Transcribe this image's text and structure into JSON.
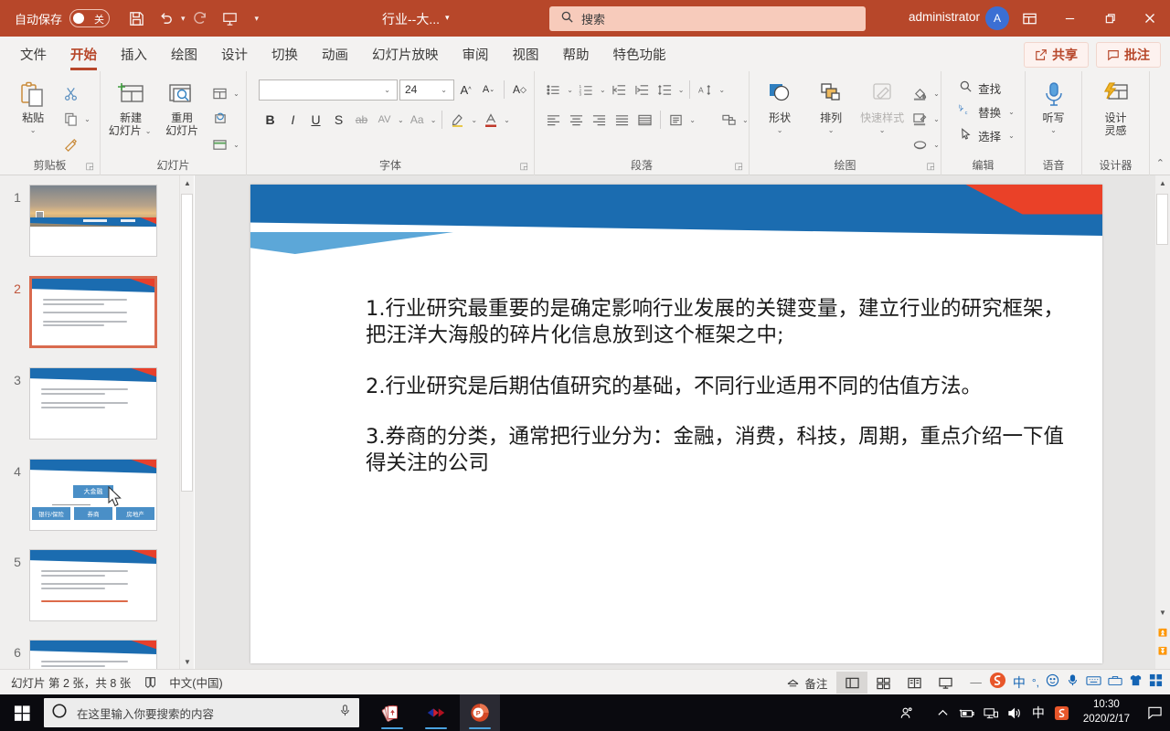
{
  "titlebar": {
    "autosave_label": "自动保存",
    "autosave_state": "关",
    "save_icon": "save-icon",
    "undo_icon": "undo-icon",
    "redo_icon": "redo-icon",
    "present_icon": "start-presentation-icon",
    "customize_icon": "customize-quick-access-icon",
    "document_title": "行业--大...",
    "search_placeholder": "搜索",
    "search_icon": "search-icon",
    "user_name": "administrator",
    "user_initial": "A",
    "ribbon_display_icon": "ribbon-display-options-icon",
    "minimize_label": "—",
    "restore_label": "❐",
    "close_label": "✕",
    "bg_color": "#b7472a",
    "search_bg": "#f7cbbb"
  },
  "menubar": {
    "tabs": [
      {
        "label": "文件",
        "active": false
      },
      {
        "label": "开始",
        "active": true
      },
      {
        "label": "插入",
        "active": false
      },
      {
        "label": "绘图",
        "active": false
      },
      {
        "label": "设计",
        "active": false
      },
      {
        "label": "切换",
        "active": false
      },
      {
        "label": "动画",
        "active": false
      },
      {
        "label": "幻灯片放映",
        "active": false
      },
      {
        "label": "审阅",
        "active": false
      },
      {
        "label": "视图",
        "active": false
      },
      {
        "label": "帮助",
        "active": false
      },
      {
        "label": "特色功能",
        "active": false
      }
    ],
    "share_label": "共享",
    "comment_label": "批注",
    "accent_color": "#b7472a"
  },
  "ribbon": {
    "clipboard": {
      "group_label": "剪贴板",
      "paste_label": "粘贴",
      "cut_name": "cut-icon",
      "copy_name": "copy-icon",
      "format_painter_name": "format-painter-icon"
    },
    "slides": {
      "group_label": "幻灯片",
      "new_slide_label": "新建\n幻灯片",
      "new_slide_line1": "新建",
      "new_slide_line2": "幻灯片",
      "reuse_label_line1": "重用",
      "reuse_label_line2": "幻灯片",
      "layout_name": "slide-layout-icon",
      "reset_name": "reset-slide-icon",
      "section_name": "slide-section-icon"
    },
    "font": {
      "group_label": "字体",
      "font_name_value": "",
      "font_size_value": "24",
      "grow_font": "A",
      "shrink_font": "A",
      "clear_format": "A",
      "bold": "B",
      "italic": "I",
      "underline": "U",
      "shadow": "S",
      "strikethrough": "ab",
      "char_spacing": "AV",
      "change_case": "Aa",
      "highlight_name": "text-highlight-icon",
      "font_color_name": "font-color-icon"
    },
    "paragraph": {
      "group_label": "段落",
      "bullets_name": "bullet-list-icon",
      "numbering_name": "numbered-list-icon",
      "decrease_indent_name": "decrease-indent-icon",
      "increase_indent_name": "increase-indent-icon",
      "line_spacing_name": "line-spacing-icon",
      "align_left_name": "align-left-icon",
      "align_center_name": "align-center-icon",
      "align_right_name": "align-right-icon",
      "justify_name": "justify-icon",
      "columns_name": "columns-icon",
      "smartart_name": "convert-to-smartart-icon",
      "text_direction_name": "text-direction-icon",
      "align_text_name": "align-text-icon"
    },
    "drawing": {
      "group_label": "绘图",
      "shapes_label": "形状",
      "arrange_label": "排列",
      "quick_styles_label": "快速样式",
      "shape_fill_name": "shape-fill-icon",
      "shape_outline_name": "shape-outline-icon",
      "shape_effects_name": "shape-effects-icon"
    },
    "editing": {
      "group_label": "编辑",
      "find_label": "查找",
      "replace_label": "替换",
      "select_label": "选择"
    },
    "voice": {
      "group_label": "语音",
      "dictate_label": "听写"
    },
    "designer": {
      "group_label": "设计器",
      "design_ideas_line1": "设计",
      "design_ideas_line2": "灵感"
    },
    "collapse_icon": "collapse-ribbon-icon"
  },
  "slide_panel": {
    "thumbnails": [
      {
        "number": "1",
        "selected": false,
        "kind": "cover"
      },
      {
        "number": "2",
        "selected": true,
        "kind": "text"
      },
      {
        "number": "3",
        "selected": false,
        "kind": "text"
      },
      {
        "number": "4",
        "selected": false,
        "kind": "diagram"
      },
      {
        "number": "5",
        "selected": false,
        "kind": "text-red"
      },
      {
        "number": "6",
        "selected": false,
        "kind": "text"
      }
    ],
    "diagram_nodes": {
      "root": "大金融",
      "children": [
        "银行/保险",
        "券商",
        "房地产"
      ]
    },
    "scroll_up_icon": "scroll-up-icon",
    "scroll_down_icon": "scroll-down-icon"
  },
  "slide": {
    "theme_blue": "#1b6cb0",
    "theme_red": "#ea4128",
    "theme_lightblue": "#5ca7d8",
    "paragraphs": [
      "1.行业研究最重要的是确定影响行业发展的关键变量，建立行业的研究框架，把汪洋大海般的碎片化信息放到这个框架之中;",
      "2.行业研究是后期估值研究的基础，不同行业适用不同的估值方法。",
      "3.券商的分类，通常把行业分为：金融，消费，科技，周期，重点介绍一下值得关注的公司"
    ]
  },
  "editor_scroll": {
    "up_icon": "scroll-up-icon",
    "down_icon": "scroll-down-icon",
    "prev_slide_icon": "previous-slide-icon",
    "next_slide_icon": "next-slide-icon"
  },
  "statusbar": {
    "slide_info": "幻灯片 第 2 张，共 8 张",
    "accessibility_icon": "accessibility-check-icon",
    "language": "中文(中国)",
    "notes_label": "备注",
    "view_normal_icon": "normal-view-icon",
    "view_sorter_icon": "slide-sorter-icon",
    "view_reading_icon": "reading-view-icon",
    "view_show_icon": "slide-show-icon",
    "zoom_minus": "—",
    "ime": {
      "sogou_icon": "sogou-input-icon",
      "mode_label": "中",
      "punct_label": "°,",
      "emoji_icon": "emoji-icon",
      "mic_icon": "microphone-icon",
      "keyboard_icon": "soft-keyboard-icon",
      "toolbox_icon": "ime-toolbox-icon",
      "skin_icon": "skin-icon",
      "apps_icon": "ime-apps-icon"
    }
  },
  "taskbar": {
    "start_icon": "windows-start-icon",
    "search_placeholder": "在这里输入你要搜索的内容",
    "cortana_icon": "cortana-circle-icon",
    "mic_icon": "microphone-icon",
    "apps": [
      {
        "name": "solitaire-app",
        "active": false
      },
      {
        "name": "media-app",
        "active": false
      },
      {
        "name": "powerpoint-app",
        "active": true
      }
    ],
    "tray": {
      "people_icon": "people-icon",
      "show_hidden_icon": "show-hidden-icons-icon",
      "battery_icon": "battery-icon",
      "network_icon": "network-icon",
      "volume_icon": "volume-icon",
      "ime_label": "中",
      "sogou_icon": "sogou-input-icon",
      "time": "10:30",
      "date": "2020/2/17",
      "action_center_icon": "action-center-icon"
    }
  }
}
